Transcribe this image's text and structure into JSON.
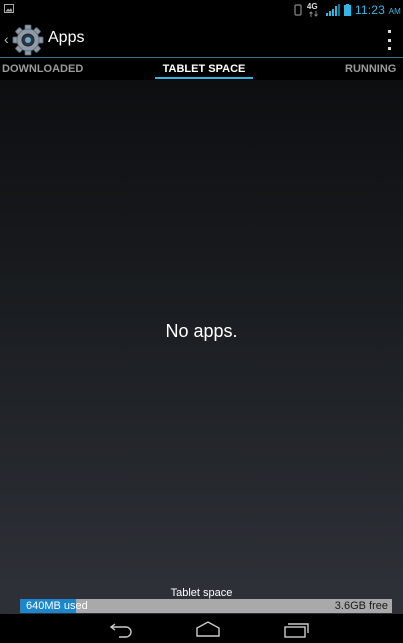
{
  "status_bar": {
    "network_label": "4G",
    "time": "11:23",
    "ampm": "AM"
  },
  "action_bar": {
    "title": "Apps"
  },
  "tabs": [
    {
      "label": "DOWNLOADED",
      "selected": false
    },
    {
      "label": "TABLET SPACE",
      "selected": true
    },
    {
      "label": "RUNNING",
      "selected": false
    }
  ],
  "content": {
    "empty_message": "No apps."
  },
  "storage": {
    "label": "Tablet space",
    "used": "640MB used",
    "free": "3.6GB free",
    "used_fraction": 0.15
  },
  "colors": {
    "accent": "#33b5e5",
    "used_bar": "#1b86cc",
    "free_bar": "#a9a9a9"
  },
  "icons": {
    "status_left": "picture-icon",
    "app": "settings-gear-icon",
    "back": "back-icon",
    "home": "home-icon",
    "recents": "recents-icon"
  }
}
